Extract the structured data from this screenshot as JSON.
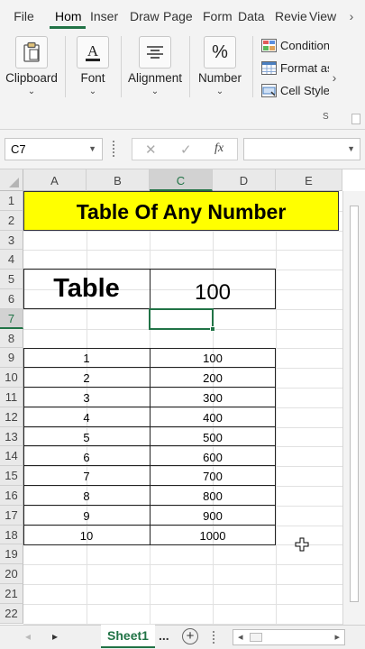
{
  "ribbon_tabs": [
    "File",
    "Hom",
    "Inser",
    "Draw",
    "Page",
    "Form",
    "Data",
    "Revie",
    "View"
  ],
  "ribbon_active_tab": "Hom",
  "groups": {
    "clipboard": {
      "label": "Clipboard",
      "icon": "clipboard-icon"
    },
    "font": {
      "label": "Font",
      "icon": "font-color-icon"
    },
    "alignment": {
      "label": "Alignment",
      "icon": "align-center-icon"
    },
    "number": {
      "label": "Number",
      "icon": "percent-icon"
    },
    "styles": {
      "items": [
        "Conditional Formatting",
        "Format as Table",
        "Cell Styles"
      ],
      "more_arrow": "›",
      "group_initial": "S"
    }
  },
  "chevron": "⌄",
  "formula_bar": {
    "name_box": "C7",
    "cancel_glyph": "✕",
    "enter_glyph": "✓",
    "fx_glyph": "fx",
    "formula": ""
  },
  "columns": [
    "A",
    "B",
    "C",
    "D",
    "E"
  ],
  "rows": [
    "1",
    "2",
    "3",
    "4",
    "5",
    "6",
    "7",
    "8",
    "9",
    "10",
    "11",
    "12",
    "13",
    "14",
    "15",
    "16",
    "17",
    "18",
    "19",
    "20",
    "21",
    "22"
  ],
  "sheet": {
    "title": "Table Of Any Number",
    "label_cell": "Table",
    "number_cell": "100",
    "multipliers": [
      "1",
      "2",
      "3",
      "4",
      "5",
      "6",
      "7",
      "8",
      "9",
      "10"
    ],
    "results": [
      "100",
      "200",
      "300",
      "400",
      "500",
      "600",
      "700",
      "800",
      "900",
      "1000"
    ]
  },
  "sheet_tabs": {
    "prev_glyph": "◂",
    "next_glyph": "▸",
    "active": "Sheet1",
    "more": "...",
    "add_glyph": "+",
    "scroll_left": "◂",
    "scroll_right": "▸"
  },
  "colors": {
    "accent": "#217346",
    "title_fill": "#ffff00"
  }
}
